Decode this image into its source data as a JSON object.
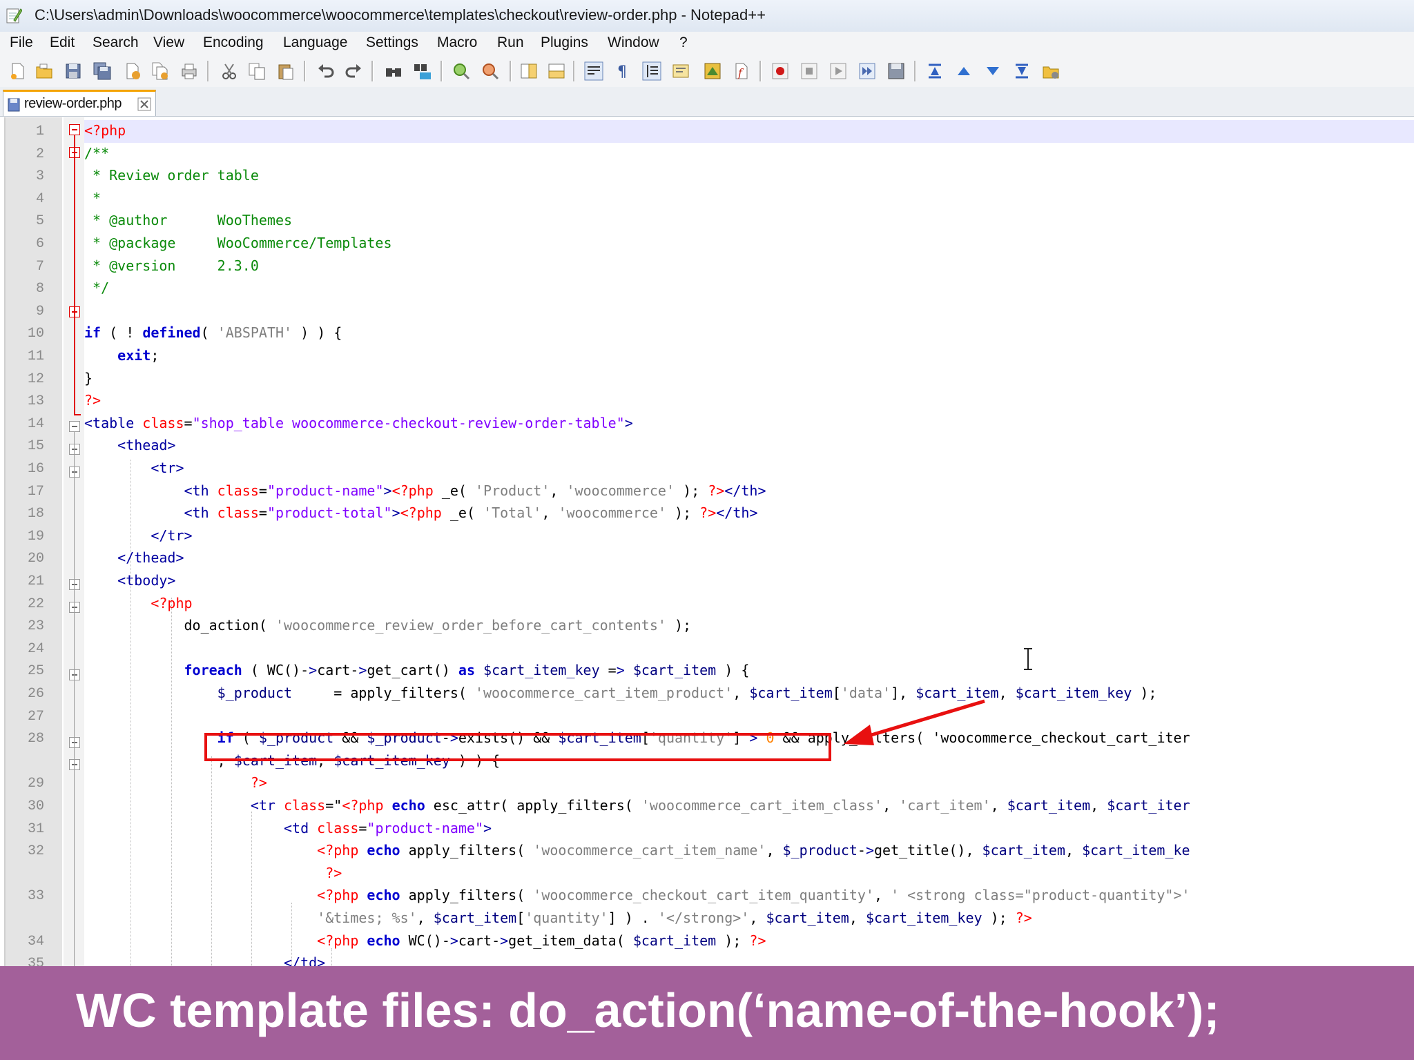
{
  "window": {
    "title": "C:\\Users\\admin\\Downloads\\woocommerce\\woocommerce\\templates\\checkout\\review-order.php - Notepad++"
  },
  "menu": [
    "File",
    "Edit",
    "Search",
    "View",
    "Encoding",
    "Language",
    "Settings",
    "Macro",
    "Run",
    "Plugins",
    "Window",
    "?"
  ],
  "toolbar_icons": [
    "new-file-icon",
    "open-file-icon",
    "save-icon",
    "save-all-icon",
    "close-icon",
    "close-all-icon",
    "print-icon",
    "cut-icon",
    "copy-icon",
    "paste-icon",
    "undo-icon",
    "redo-icon",
    "find-icon",
    "replace-icon",
    "zoom-in-icon",
    "zoom-out-icon",
    "sync-vertical-icon",
    "sync-horizontal-icon",
    "word-wrap-icon",
    "show-all-chars-icon",
    "indent-guide-icon",
    "language-icon",
    "doc-map-icon",
    "function-list-icon",
    "record-macro-icon",
    "stop-macro-icon",
    "play-macro-icon",
    "run-macro-multiple-icon",
    "save-macro-icon",
    "collapse-icon",
    "up-icon",
    "down-icon",
    "expand-icon",
    "folder-icon"
  ],
  "tab": {
    "label": "review-order.php"
  },
  "lines": [
    {
      "n": "1",
      "code": "<?php"
    },
    {
      "n": "2",
      "code": "/**"
    },
    {
      "n": "3",
      "code": " * Review order table"
    },
    {
      "n": "4",
      "code": " *"
    },
    {
      "n": "5",
      "code": " * @author      WooThemes"
    },
    {
      "n": "6",
      "code": " * @package     WooCommerce/Templates"
    },
    {
      "n": "7",
      "code": " * @version     2.3.0"
    },
    {
      "n": "8",
      "code": " */"
    },
    {
      "n": "9",
      "code": ""
    },
    {
      "n": "10",
      "code": "if ( ! defined( 'ABSPATH' ) ) {"
    },
    {
      "n": "11",
      "code": "    exit;"
    },
    {
      "n": "12",
      "code": "}"
    },
    {
      "n": "13",
      "code": "?>"
    },
    {
      "n": "14",
      "code": "<table class=\"shop_table woocommerce-checkout-review-order-table\">"
    },
    {
      "n": "15",
      "code": "    <thead>"
    },
    {
      "n": "16",
      "code": "        <tr>"
    },
    {
      "n": "17",
      "code": "            <th class=\"product-name\"><?php _e( 'Product', 'woocommerce' ); ?></th>"
    },
    {
      "n": "18",
      "code": "            <th class=\"product-total\"><?php _e( 'Total', 'woocommerce' ); ?></th>"
    },
    {
      "n": "19",
      "code": "        </tr>"
    },
    {
      "n": "20",
      "code": "    </thead>"
    },
    {
      "n": "21",
      "code": "    <tbody>"
    },
    {
      "n": "22",
      "code": "        <?php"
    },
    {
      "n": "23",
      "code": "            do_action( 'woocommerce_review_order_before_cart_contents' );"
    },
    {
      "n": "24",
      "code": ""
    },
    {
      "n": "25",
      "code": "            foreach ( WC()->cart->get_cart() as $cart_item_key => $cart_item ) {"
    },
    {
      "n": "26",
      "code": "                $_product     = apply_filters( 'woocommerce_cart_item_product', $cart_item['data'], $cart_item, $cart_item_key );"
    },
    {
      "n": "27",
      "code": ""
    },
    {
      "n": "28",
      "code": "                if ( $_product && $_product->exists() && $cart_item['quantity'] > 0 && apply_filters( 'woocommerce_checkout_cart_iter"
    },
    {
      "n": "",
      "code": "                , $cart_item, $cart_item_key ) ) {"
    },
    {
      "n": "29",
      "code": "                    ?>"
    },
    {
      "n": "30",
      "code": "                    <tr class=\"<?php echo esc_attr( apply_filters( 'woocommerce_cart_item_class', 'cart_item', $cart_item, $cart_iter"
    },
    {
      "n": "31",
      "code": "                        <td class=\"product-name\">"
    },
    {
      "n": "32",
      "code": "                            <?php echo apply_filters( 'woocommerce_cart_item_name', $_product->get_title(), $cart_item, $cart_item_ke"
    },
    {
      "n": "",
      "code": "                             ?>"
    },
    {
      "n": "33",
      "code": "                            <?php echo apply_filters( 'woocommerce_checkout_cart_item_quantity', ' <strong class=\"product-quantity\">'"
    },
    {
      "n": "",
      "code": "                            '&times; %s', $cart_item['quantity'] ) . '</strong>', $cart_item, $cart_item_key ); ?>"
    },
    {
      "n": "34",
      "code": "                            <?php echo WC()->cart->get_item_data( $cart_item ); ?>"
    },
    {
      "n": "35",
      "code": "                        </td>"
    }
  ],
  "caption": {
    "text": "WC template files: do_action(‘name-of-the-hook’);"
  }
}
